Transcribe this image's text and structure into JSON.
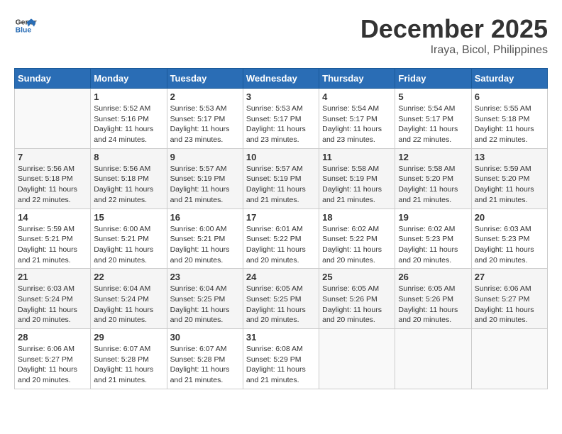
{
  "header": {
    "logo_line1": "General",
    "logo_line2": "Blue",
    "month": "December 2025",
    "location": "Iraya, Bicol, Philippines"
  },
  "weekdays": [
    "Sunday",
    "Monday",
    "Tuesday",
    "Wednesday",
    "Thursday",
    "Friday",
    "Saturday"
  ],
  "weeks": [
    [
      {
        "day": "",
        "empty": true
      },
      {
        "day": "1",
        "sunrise": "5:52 AM",
        "sunset": "5:16 PM",
        "daylight": "11 hours and 24 minutes."
      },
      {
        "day": "2",
        "sunrise": "5:53 AM",
        "sunset": "5:17 PM",
        "daylight": "11 hours and 23 minutes."
      },
      {
        "day": "3",
        "sunrise": "5:53 AM",
        "sunset": "5:17 PM",
        "daylight": "11 hours and 23 minutes."
      },
      {
        "day": "4",
        "sunrise": "5:54 AM",
        "sunset": "5:17 PM",
        "daylight": "11 hours and 23 minutes."
      },
      {
        "day": "5",
        "sunrise": "5:54 AM",
        "sunset": "5:17 PM",
        "daylight": "11 hours and 22 minutes."
      },
      {
        "day": "6",
        "sunrise": "5:55 AM",
        "sunset": "5:18 PM",
        "daylight": "11 hours and 22 minutes."
      }
    ],
    [
      {
        "day": "7",
        "sunrise": "5:56 AM",
        "sunset": "5:18 PM",
        "daylight": "11 hours and 22 minutes."
      },
      {
        "day": "8",
        "sunrise": "5:56 AM",
        "sunset": "5:18 PM",
        "daylight": "11 hours and 22 minutes."
      },
      {
        "day": "9",
        "sunrise": "5:57 AM",
        "sunset": "5:19 PM",
        "daylight": "11 hours and 21 minutes."
      },
      {
        "day": "10",
        "sunrise": "5:57 AM",
        "sunset": "5:19 PM",
        "daylight": "11 hours and 21 minutes."
      },
      {
        "day": "11",
        "sunrise": "5:58 AM",
        "sunset": "5:19 PM",
        "daylight": "11 hours and 21 minutes."
      },
      {
        "day": "12",
        "sunrise": "5:58 AM",
        "sunset": "5:20 PM",
        "daylight": "11 hours and 21 minutes."
      },
      {
        "day": "13",
        "sunrise": "5:59 AM",
        "sunset": "5:20 PM",
        "daylight": "11 hours and 21 minutes."
      }
    ],
    [
      {
        "day": "14",
        "sunrise": "5:59 AM",
        "sunset": "5:21 PM",
        "daylight": "11 hours and 21 minutes."
      },
      {
        "day": "15",
        "sunrise": "6:00 AM",
        "sunset": "5:21 PM",
        "daylight": "11 hours and 20 minutes."
      },
      {
        "day": "16",
        "sunrise": "6:00 AM",
        "sunset": "5:21 PM",
        "daylight": "11 hours and 20 minutes."
      },
      {
        "day": "17",
        "sunrise": "6:01 AM",
        "sunset": "5:22 PM",
        "daylight": "11 hours and 20 minutes."
      },
      {
        "day": "18",
        "sunrise": "6:02 AM",
        "sunset": "5:22 PM",
        "daylight": "11 hours and 20 minutes."
      },
      {
        "day": "19",
        "sunrise": "6:02 AM",
        "sunset": "5:23 PM",
        "daylight": "11 hours and 20 minutes."
      },
      {
        "day": "20",
        "sunrise": "6:03 AM",
        "sunset": "5:23 PM",
        "daylight": "11 hours and 20 minutes."
      }
    ],
    [
      {
        "day": "21",
        "sunrise": "6:03 AM",
        "sunset": "5:24 PM",
        "daylight": "11 hours and 20 minutes."
      },
      {
        "day": "22",
        "sunrise": "6:04 AM",
        "sunset": "5:24 PM",
        "daylight": "11 hours and 20 minutes."
      },
      {
        "day": "23",
        "sunrise": "6:04 AM",
        "sunset": "5:25 PM",
        "daylight": "11 hours and 20 minutes."
      },
      {
        "day": "24",
        "sunrise": "6:05 AM",
        "sunset": "5:25 PM",
        "daylight": "11 hours and 20 minutes."
      },
      {
        "day": "25",
        "sunrise": "6:05 AM",
        "sunset": "5:26 PM",
        "daylight": "11 hours and 20 minutes."
      },
      {
        "day": "26",
        "sunrise": "6:05 AM",
        "sunset": "5:26 PM",
        "daylight": "11 hours and 20 minutes."
      },
      {
        "day": "27",
        "sunrise": "6:06 AM",
        "sunset": "5:27 PM",
        "daylight": "11 hours and 20 minutes."
      }
    ],
    [
      {
        "day": "28",
        "sunrise": "6:06 AM",
        "sunset": "5:27 PM",
        "daylight": "11 hours and 20 minutes."
      },
      {
        "day": "29",
        "sunrise": "6:07 AM",
        "sunset": "5:28 PM",
        "daylight": "11 hours and 21 minutes."
      },
      {
        "day": "30",
        "sunrise": "6:07 AM",
        "sunset": "5:28 PM",
        "daylight": "11 hours and 21 minutes."
      },
      {
        "day": "31",
        "sunrise": "6:08 AM",
        "sunset": "5:29 PM",
        "daylight": "11 hours and 21 minutes."
      },
      {
        "day": "",
        "empty": true
      },
      {
        "day": "",
        "empty": true
      },
      {
        "day": "",
        "empty": true
      }
    ]
  ]
}
